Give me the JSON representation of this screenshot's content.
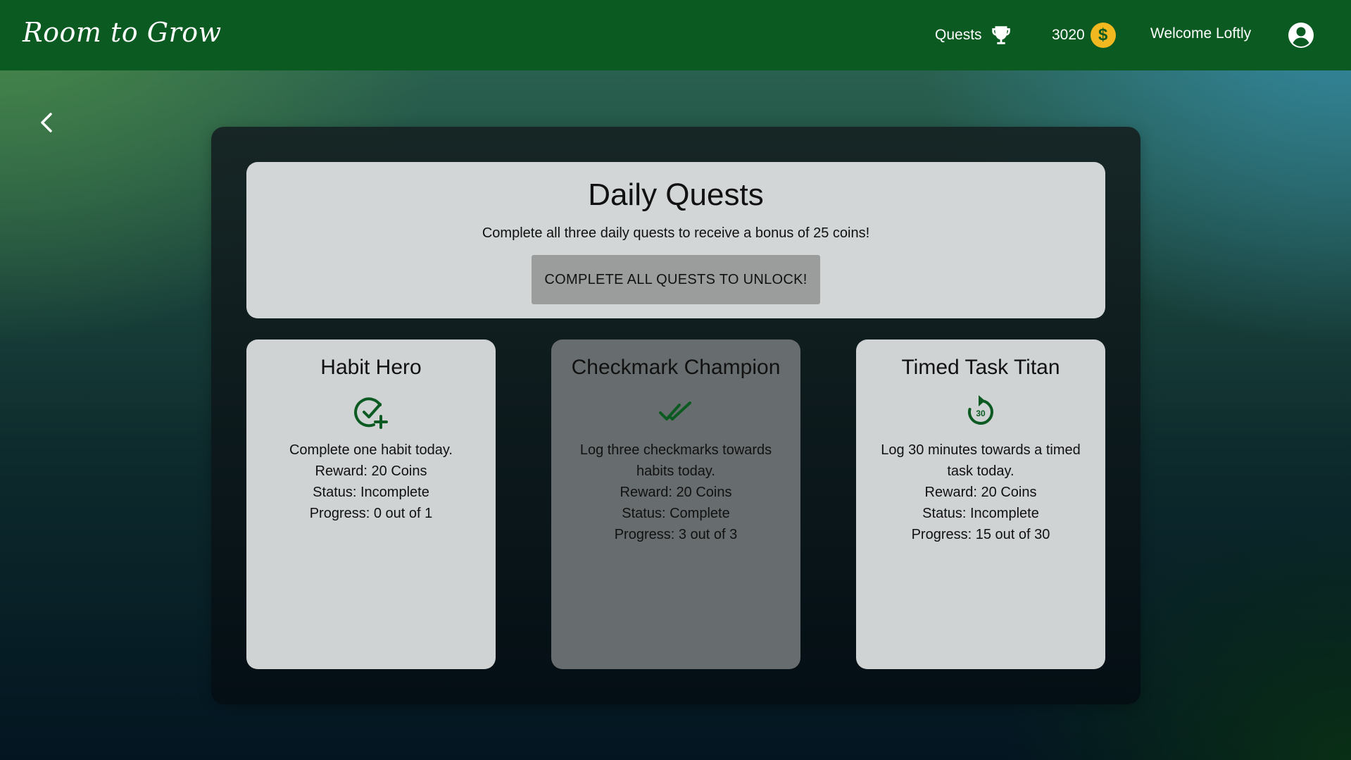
{
  "topbar": {
    "logo": "Room to Grow",
    "quests_label": "Quests",
    "coins": "3020",
    "coin_symbol": "$",
    "welcome": "Welcome Loftly"
  },
  "header": {
    "title": "Daily Quests",
    "subtitle": "Complete all three daily quests to receive a bonus of 25 coins!",
    "unlock_button": "COMPLETE ALL QUESTS TO UNLOCK!"
  },
  "quests": [
    {
      "title": "Habit Hero",
      "icon": "check-circle-plus-icon",
      "description": "Complete one habit today.",
      "reward": "Reward: 20 Coins",
      "status": "Status: Incomplete",
      "progress": "Progress: 0 out of 1",
      "completed": false
    },
    {
      "title": "Checkmark Champion",
      "icon": "double-check-icon",
      "description": "Log three checkmarks towards habits today.",
      "reward": "Reward: 20 Coins",
      "status": "Status: Complete",
      "progress": "Progress: 3 out of 3",
      "completed": true
    },
    {
      "title": "Timed Task Titan",
      "icon": "timer-30-icon",
      "icon_text": "30",
      "description": "Log 30 minutes towards a timed task today.",
      "reward": "Reward: 20 Coins",
      "status": "Status: Incomplete",
      "progress": "Progress: 15 out of 30",
      "completed": false
    }
  ],
  "colors": {
    "topbar": "#0b5a22",
    "accent_green": "#0b5a22",
    "coin": "#f2b81f",
    "card": "#cfd3d4",
    "card_complete": "#676d6e"
  }
}
